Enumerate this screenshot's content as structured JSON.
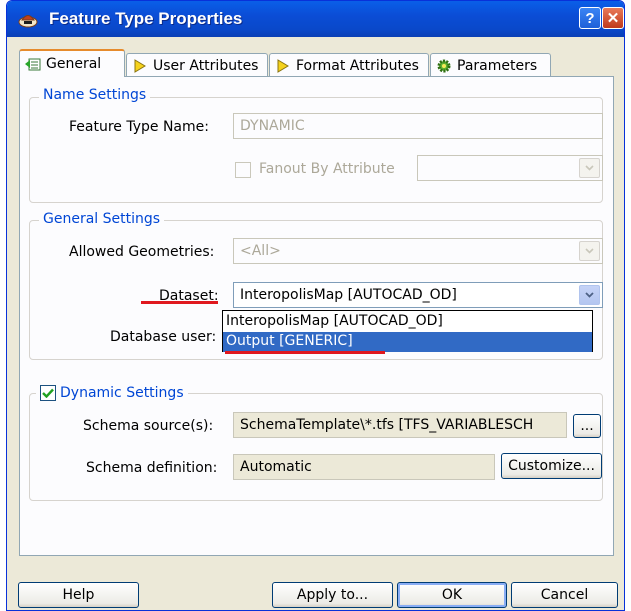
{
  "window": {
    "title": "Feature Type Properties",
    "help_button": "?",
    "close_button": "✕"
  },
  "tabs": [
    {
      "label": "General",
      "active": true,
      "icon": "general-tab-icon"
    },
    {
      "label": "User Attributes",
      "active": false,
      "icon": "yellow-diamond-arrow-icon"
    },
    {
      "label": "Format Attributes",
      "active": false,
      "icon": "yellow-diamond-arrow-icon"
    },
    {
      "label": "Parameters",
      "active": false,
      "icon": "gear-icon"
    }
  ],
  "name_settings": {
    "title": "Name Settings",
    "feature_type_name_label": "Feature Type Name:",
    "feature_type_name_value": "DYNAMIC",
    "fanout_label": "Fanout By Attribute",
    "fanout_checked": false
  },
  "general_settings": {
    "title": "General Settings",
    "allowed_geometries_label": "Allowed Geometries:",
    "allowed_geometries_value": "<All>",
    "dataset_label": "Dataset:",
    "dataset_value": "InteropolisMap [AUTOCAD_OD]",
    "database_user_label": "Database user:",
    "dataset_options": [
      "InteropolisMap [AUTOCAD_OD]",
      "Output [GENERIC]"
    ],
    "dataset_highlighted_option": "Output [GENERIC]"
  },
  "dynamic_settings": {
    "title": "Dynamic Settings",
    "enabled": true,
    "schema_sources_label": "Schema source(s):",
    "schema_sources_value": "SchemaTemplate\\*.tfs [TFS_VARIABLESCH",
    "browse_button": "...",
    "schema_definition_label": "Schema definition:",
    "schema_definition_value": "Automatic",
    "customize_button": "Customize..."
  },
  "footer": {
    "help_button": "Help",
    "apply_button": "Apply to...",
    "ok_button": "OK",
    "cancel_button": "Cancel"
  },
  "colors": {
    "titlebar": "#0a4fd8",
    "group_title": "#0046d5",
    "selection": "#316ac5",
    "annotation_underline": "#e0181e"
  }
}
